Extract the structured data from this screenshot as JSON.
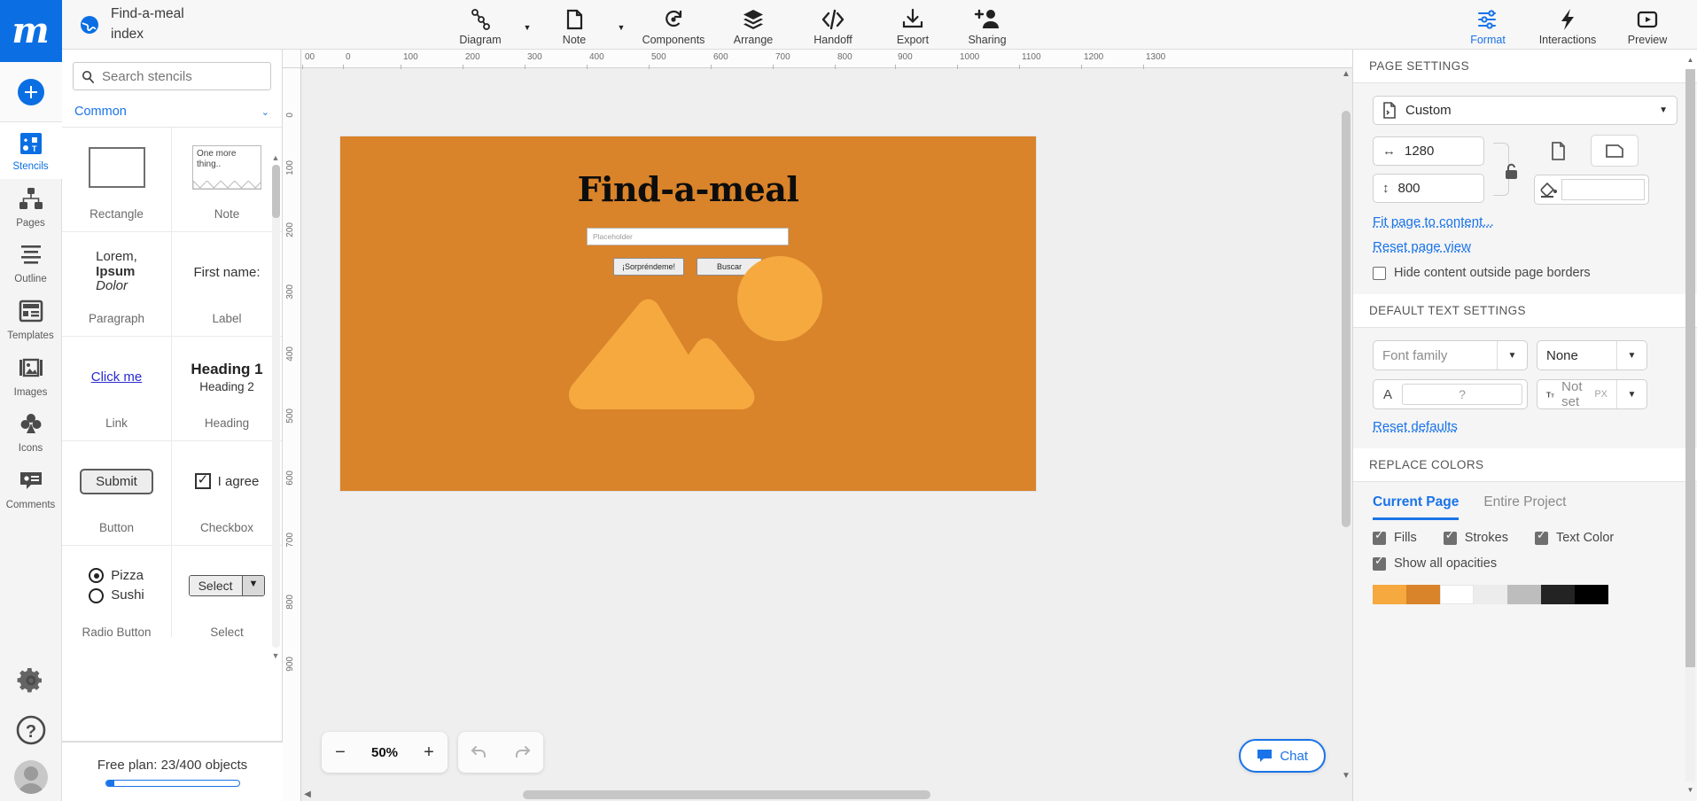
{
  "brand": {
    "logo_text": "m"
  },
  "rail": {
    "add_label": "add-new",
    "items": [
      {
        "label": "Stencils",
        "icon": "stencils-icon",
        "active": true
      },
      {
        "label": "Pages",
        "icon": "pages-icon",
        "active": false
      },
      {
        "label": "Outline",
        "icon": "outline-icon",
        "active": false
      },
      {
        "label": "Templates",
        "icon": "templates-icon",
        "active": false
      },
      {
        "label": "Images",
        "icon": "images-icon",
        "active": false
      },
      {
        "label": "Icons",
        "icon": "icons-icon",
        "active": false
      },
      {
        "label": "Comments",
        "icon": "comments-icon",
        "active": false
      }
    ],
    "settings_icon": "gear-icon",
    "help_icon": "help-icon",
    "avatar": "user-avatar"
  },
  "document": {
    "title": "Find-a-meal",
    "page_name": "index",
    "icon": "globe-icon"
  },
  "toolbar": {
    "tools": [
      {
        "label": "Diagram",
        "icon": "diagram-icon",
        "has_caret": true
      },
      {
        "label": "Note",
        "icon": "note-icon",
        "has_caret": true
      },
      {
        "label": "Components",
        "icon": "components-icon",
        "has_caret": false
      },
      {
        "label": "Arrange",
        "icon": "arrange-icon",
        "has_caret": false
      },
      {
        "label": "Handoff",
        "icon": "handoff-icon",
        "has_caret": false
      },
      {
        "label": "Export",
        "icon": "export-icon",
        "has_caret": false
      },
      {
        "label": "Sharing",
        "icon": "sharing-icon",
        "has_caret": false
      }
    ],
    "right_tools": [
      {
        "label": "Format",
        "icon": "format-sliders-icon",
        "active": true
      },
      {
        "label": "Interactions",
        "icon": "lightning-icon",
        "active": false
      },
      {
        "label": "Preview",
        "icon": "play-icon",
        "active": false
      }
    ]
  },
  "stencils": {
    "search_placeholder": "Search stencils",
    "search_value": "",
    "search_icon": "search-icon",
    "category": "Common",
    "collapse_icon": "chevron-down-icon",
    "items": [
      {
        "caption": "Rectangle",
        "preview": ""
      },
      {
        "caption": "Note",
        "preview": "One more thing.."
      },
      {
        "caption": "Paragraph",
        "preview_lines": [
          "Lorem,",
          "Ipsum",
          "Dolor"
        ]
      },
      {
        "caption": "Label",
        "preview": "First name:"
      },
      {
        "caption": "Link",
        "preview": "Click me"
      },
      {
        "caption": "Heading",
        "preview_h1": "Heading 1",
        "preview_h2": "Heading 2"
      },
      {
        "caption": "Button",
        "preview": "Submit"
      },
      {
        "caption": "Checkbox",
        "preview": "I agree"
      },
      {
        "caption": "Radio Button",
        "preview_a": "Pizza",
        "preview_b": "Sushi"
      },
      {
        "caption": "Select",
        "preview": "Select"
      }
    ],
    "plan": {
      "text": "Free plan: 23/400 objects",
      "progress_percent": 6
    }
  },
  "canvas": {
    "ruler_h": [
      "00",
      "0",
      "100",
      "200",
      "300",
      "400",
      "500",
      "600",
      "700",
      "800",
      "900",
      "1000",
      "1100",
      "1200",
      "1300"
    ],
    "ruler_v": [
      "0",
      "100",
      "200",
      "300",
      "400",
      "500",
      "600",
      "700",
      "800",
      "900"
    ],
    "zoom": {
      "value": "50%",
      "minus": "−",
      "plus": "+"
    },
    "undo_icon": "undo-icon",
    "redo_icon": "redo-icon",
    "chat": {
      "label": "Chat",
      "icon": "chat-icon"
    },
    "mockup": {
      "title": "Find-a-meal",
      "search_placeholder": "Placeholder",
      "button_surprise": "¡Sorpréndeme!",
      "button_search": "Buscar",
      "background_color": "#d9832a",
      "accent_color": "#f5a93f"
    }
  },
  "right_panel": {
    "page_settings": {
      "heading": "PAGE SETTINGS",
      "preset": "Custom",
      "preset_icon": "page-preset-icon",
      "width": "1280",
      "height": "800",
      "width_icon": "width-arrows-icon",
      "height_icon": "height-arrows-icon",
      "lock_icon": "unlocked-icon",
      "portrait_icon": "portrait-icon",
      "landscape_icon": "landscape-icon",
      "fill_icon": "paint-bucket-icon",
      "fill_value": "",
      "fit_link": "Fit page to content...",
      "reset_link": "Reset page view",
      "hide_content_label": "Hide content outside page borders",
      "hide_content_checked": false
    },
    "text_settings": {
      "heading": "DEFAULT TEXT SETTINGS",
      "font_family_placeholder": "Font family",
      "font_style": "None",
      "color_icon": "A",
      "color_value": "?",
      "size_icon": "font-size-icon",
      "size_value": "Not set",
      "size_unit": "PX",
      "reset_link": "Reset defaults"
    },
    "replace_colors": {
      "heading": "REPLACE COLORS",
      "tabs": [
        {
          "label": "Current Page",
          "active": true
        },
        {
          "label": "Entire Project",
          "active": false
        }
      ],
      "options": [
        {
          "label": "Fills",
          "checked": true
        },
        {
          "label": "Strokes",
          "checked": true
        },
        {
          "label": "Text Color",
          "checked": true
        }
      ],
      "opacity_option": {
        "label": "Show all opacities",
        "checked": true
      },
      "swatches": [
        "#f5a93f",
        "#d9832a",
        "#ffffff",
        "#ececec",
        "#bdbdbd",
        "#232323",
        "#000000"
      ]
    }
  }
}
